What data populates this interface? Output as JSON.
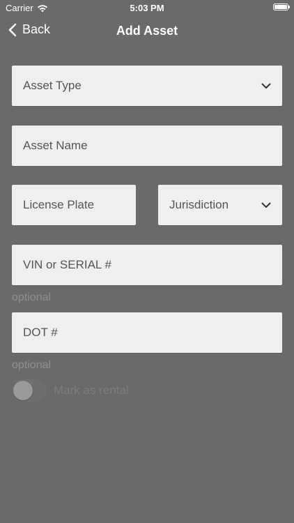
{
  "status_bar": {
    "carrier": "Carrier",
    "time": "5:03 PM"
  },
  "nav": {
    "back_label": "Back",
    "title": "Add Asset"
  },
  "form": {
    "asset_type": "Asset Type",
    "asset_name": "Asset Name",
    "license_plate": "License Plate",
    "jurisdiction": "Jurisdiction",
    "vin": "VIN or SERIAL #",
    "vin_helper": "optional",
    "dot": "DOT #",
    "dot_helper": "optional",
    "rental_label": "Mark as rental"
  },
  "colors": {
    "background": "#6a6a6a",
    "field": "#efefef",
    "field_text": "#555555",
    "helper_text": "#8e8e8e"
  }
}
